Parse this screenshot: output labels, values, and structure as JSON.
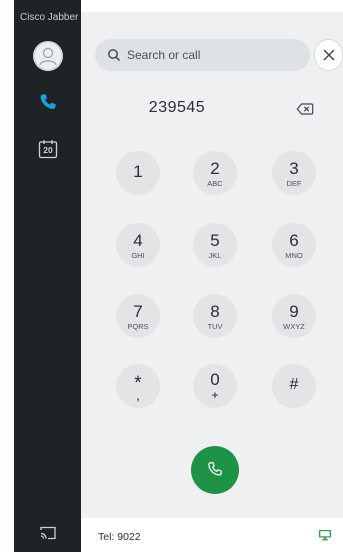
{
  "app": {
    "title": "Cisco Jabber"
  },
  "sidebar": {
    "items": [
      {
        "name": "avatar",
        "icon": "person-avatar-icon"
      },
      {
        "name": "calls",
        "icon": "phone-icon",
        "active": true
      },
      {
        "name": "calendar",
        "icon": "calendar-icon",
        "badge": "20"
      },
      {
        "name": "cast",
        "icon": "screen-cast-icon"
      }
    ]
  },
  "search": {
    "placeholder": "Search or call",
    "icon": "search-icon",
    "close_icon": "close-icon"
  },
  "dialpad": {
    "number": "239545",
    "backspace_icon": "backspace-icon",
    "keys": [
      {
        "digit": "1",
        "letters": ""
      },
      {
        "digit": "2",
        "letters": "ABC"
      },
      {
        "digit": "3",
        "letters": "DEF"
      },
      {
        "digit": "4",
        "letters": "GHI"
      },
      {
        "digit": "5",
        "letters": "JKL"
      },
      {
        "digit": "6",
        "letters": "MNO"
      },
      {
        "digit": "7",
        "letters": "PQRS"
      },
      {
        "digit": "8",
        "letters": "TUV"
      },
      {
        "digit": "9",
        "letters": "WXYZ"
      },
      {
        "digit": "*",
        "letters": ","
      },
      {
        "digit": "0",
        "letters": "+"
      },
      {
        "digit": "#",
        "letters": ""
      }
    ],
    "call_icon": "phone-icon"
  },
  "footer": {
    "tel": "Tel: 9022",
    "status_icon": "monitor-icon"
  },
  "colors": {
    "sidebar_bg": "#1e2326",
    "panel_bg": "#eef0f1",
    "key_bg": "#e2e4e6",
    "accent_blue": "#1ba0d7",
    "call_green": "#1f9345",
    "status_green": "#2f9d4b"
  }
}
